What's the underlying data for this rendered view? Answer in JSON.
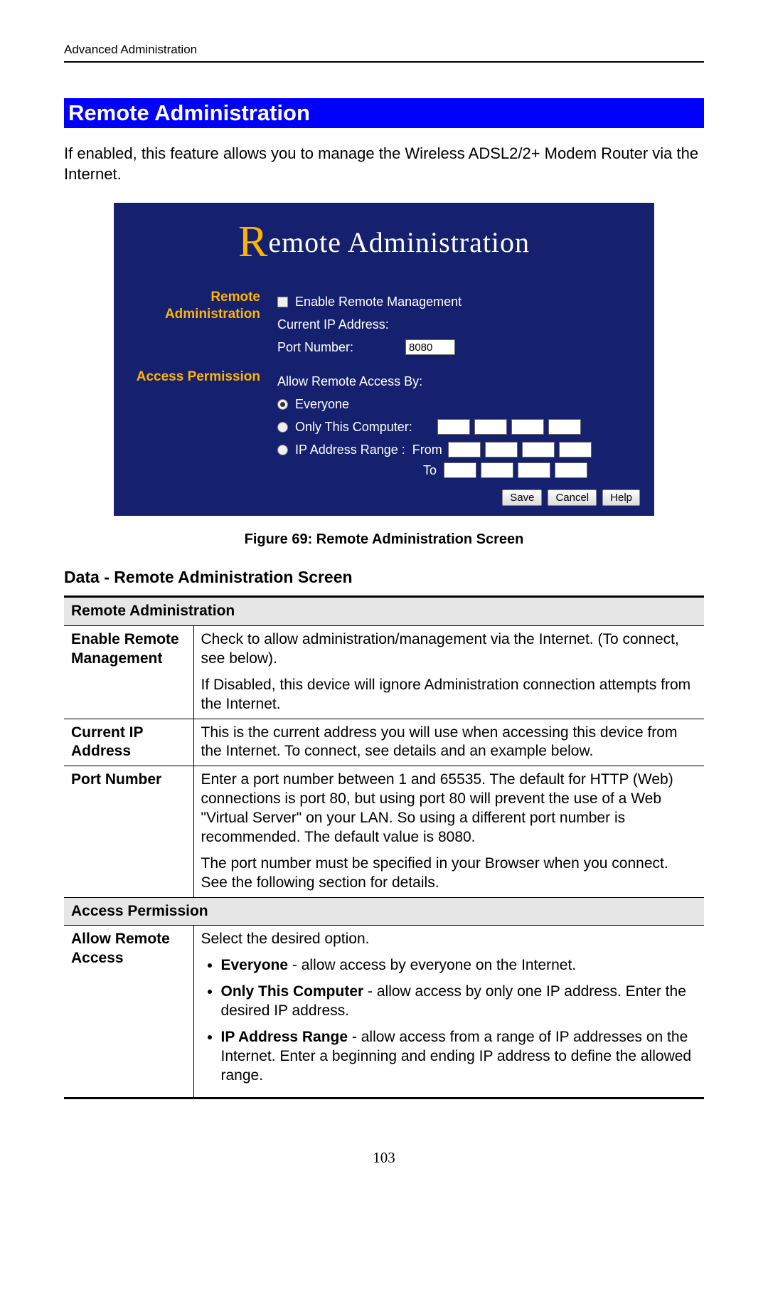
{
  "header": {
    "running": "Advanced Administration"
  },
  "section": {
    "title": "Remote Administration",
    "intro": "If enabled, this feature allows you to manage the Wireless ADSL2/2+ Modem Router via the Internet."
  },
  "screenshot": {
    "title_prefix": "R",
    "title_rest": "emote Administration",
    "remote_admin": {
      "section_label": "Remote Administration",
      "enable_label": "Enable Remote Management",
      "current_ip_label": "Current IP Address:",
      "port_label": "Port Number:",
      "port_value": "8080"
    },
    "access": {
      "section_label": "Access Permission",
      "allow_label": "Allow Remote Access By:",
      "opt_everyone": "Everyone",
      "opt_only": "Only This Computer:",
      "opt_range": "IP Address Range :",
      "from_label": "From",
      "to_label": "To"
    },
    "buttons": {
      "save": "Save",
      "cancel": "Cancel",
      "help": "Help"
    }
  },
  "figure_caption": "Figure 69: Remote Administration Screen",
  "data_heading": "Data - Remote Administration Screen",
  "table": {
    "cat_remote": "Remote Administration",
    "row_enable": {
      "label": "Enable Remote Management",
      "p1": "Check to allow administration/management via the Internet. (To connect, see below).",
      "p2": "If Disabled, this device will ignore Administration connection attempts from the Internet."
    },
    "row_ip": {
      "label": "Current IP Address",
      "p1": "This is the current address you will use when accessing this device from the Internet. To connect, see details and an example below."
    },
    "row_port": {
      "label": "Port Number",
      "p1": "Enter a port number between 1 and 65535. The default for HTTP (Web) connections is port 80, but using port 80 will prevent the use of a Web \"Virtual Server\" on your LAN. So using a different port number is recommended. The default value is 8080.",
      "p2": "The port number must be specified in your Browser when you connect. See the following section for details."
    },
    "cat_access": "Access Permission",
    "row_allow": {
      "label": "Allow Remote Access",
      "intro": "Select the desired option.",
      "li1_b": "Everyone",
      "li1_t": " - allow access by everyone on the Internet.",
      "li2_b": "Only This Computer",
      "li2_t": " - allow access by only one IP address. Enter the desired IP address.",
      "li3_b": "IP Address Range",
      "li3_t": " - allow access from a range of IP addresses on the Internet. Enter a beginning and ending IP address to define the allowed range."
    }
  },
  "page_number": "103"
}
